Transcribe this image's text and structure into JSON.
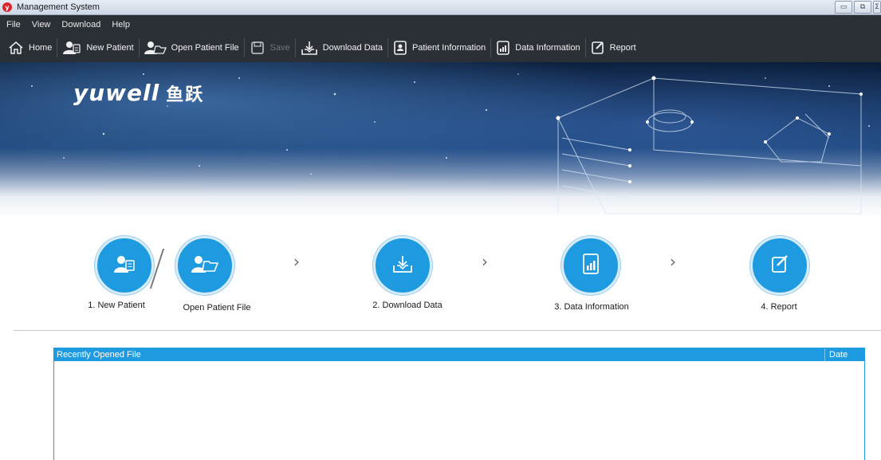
{
  "window": {
    "title": "Management System",
    "logo_letter": "y",
    "buttons": [
      "▭",
      "⧉",
      "Σ"
    ]
  },
  "menu": [
    "File",
    "View",
    "Download",
    "Help"
  ],
  "toolbar": {
    "items": [
      {
        "label": "Home",
        "icon": "home-icon",
        "enabled": true
      },
      {
        "label": "New Patient",
        "icon": "new-patient-icon",
        "enabled": true
      },
      {
        "label": "Open Patient File",
        "icon": "open-patient-file-icon",
        "enabled": true
      },
      {
        "label": "Save",
        "icon": "save-icon",
        "enabled": false
      },
      {
        "label": "Download Data",
        "icon": "download-icon",
        "enabled": true
      },
      {
        "label": "Patient Information",
        "icon": "patient-info-icon",
        "enabled": true
      },
      {
        "label": "Data Information",
        "icon": "data-info-icon",
        "enabled": true
      },
      {
        "label": "Report",
        "icon": "report-icon",
        "enabled": true
      }
    ]
  },
  "banner": {
    "brand": "yuwell",
    "brand_cn": "鱼跃"
  },
  "steps": {
    "new_patient": "1. New Patient",
    "open_patient_file": "Open Patient File",
    "download_data": "2. Download Data",
    "data_information": "3. Data Information",
    "report": "4. Report",
    "arrow": "›"
  },
  "recent": {
    "header_file": "Recently Opened File",
    "header_date": "Date",
    "rows": []
  },
  "colors": {
    "accent": "#1e9be0",
    "toolbar_bg": "#2b2f36"
  }
}
